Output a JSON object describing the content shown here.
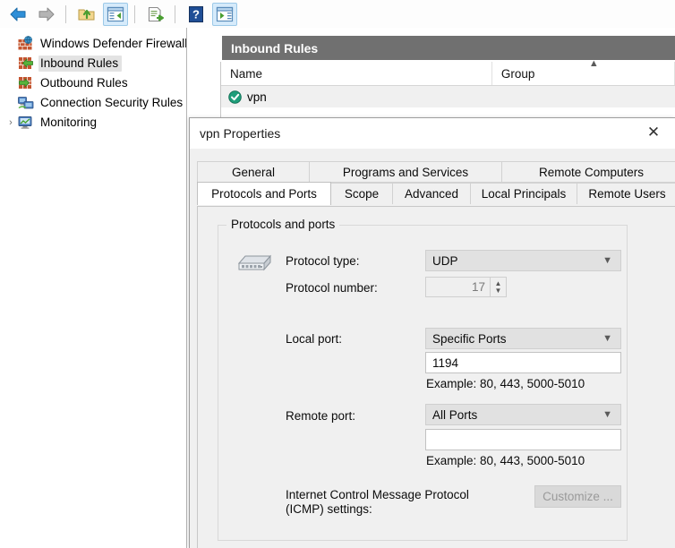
{
  "toolbar": {
    "buttons": [
      {
        "name": "back",
        "label": "Back",
        "icon": "back-arrow-icon",
        "checked": false
      },
      {
        "name": "forward",
        "label": "Forward",
        "icon": "forward-arrow-icon",
        "checked": false
      },
      {
        "name": "up-folder",
        "label": "Up One Level",
        "icon": "up-folder-icon",
        "checked": false
      },
      {
        "name": "show-hide-tree",
        "label": "Show/Hide Console Tree",
        "icon": "console-tree-icon",
        "checked": true
      },
      {
        "name": "export-list",
        "label": "Export List",
        "icon": "export-list-icon",
        "checked": false
      },
      {
        "name": "help",
        "label": "Help",
        "icon": "help-icon",
        "checked": false
      },
      {
        "name": "show-hide-action-pane",
        "label": "Show/Hide Action Pane",
        "icon": "action-pane-icon",
        "checked": true
      }
    ]
  },
  "tree": {
    "items": [
      {
        "label": "Windows Defender Firewall witl",
        "icon": "firewall-globe-icon",
        "indent": 0,
        "twisty": "",
        "selected": false
      },
      {
        "label": "Inbound Rules",
        "icon": "inbound-rules-icon",
        "indent": 1,
        "twisty": "",
        "selected": true
      },
      {
        "label": "Outbound Rules",
        "icon": "outbound-rules-icon",
        "indent": 1,
        "twisty": "",
        "selected": false
      },
      {
        "label": "Connection Security Rules",
        "icon": "connection-security-icon",
        "indent": 1,
        "twisty": "",
        "selected": false
      },
      {
        "label": "Monitoring",
        "icon": "monitoring-icon",
        "indent": 1,
        "twisty": "›",
        "selected": false
      }
    ]
  },
  "list": {
    "header": "Inbound Rules",
    "columns": [
      {
        "label": "Name",
        "sorted": false
      },
      {
        "label": "Group",
        "sorted": true,
        "sort_direction": "ascending"
      }
    ],
    "rows": [
      {
        "name": "vpn",
        "group": "",
        "icon": "enabled-check-icon"
      }
    ]
  },
  "dialog": {
    "title": "vpn Properties",
    "close_label": "✕",
    "tabs_row1": [
      {
        "label": "General",
        "active": false
      },
      {
        "label": "Programs and Services",
        "active": false
      },
      {
        "label": "Remote Computers",
        "active": false
      }
    ],
    "tabs_row2": [
      {
        "label": "Protocols and Ports",
        "active": true
      },
      {
        "label": "Scope",
        "active": false
      },
      {
        "label": "Advanced",
        "active": false
      },
      {
        "label": "Local Principals",
        "active": false
      },
      {
        "label": "Remote Users",
        "active": false
      }
    ],
    "group_title": "Protocols and ports",
    "protocol_icon": "network-switch-icon",
    "fields": {
      "protocol_type_label": "Protocol type:",
      "protocol_type_value": "UDP",
      "protocol_number_label": "Protocol number:",
      "protocol_number_value": "17",
      "local_port_label": "Local port:",
      "local_port_value": "Specific Ports",
      "local_port_list": "1194",
      "local_port_example": "Example: 80, 443, 5000-5010",
      "remote_port_label": "Remote port:",
      "remote_port_value": "All Ports",
      "remote_port_list": "",
      "remote_port_example": "Example: 80, 443, 5000-5010",
      "icmp_label": "Internet Control Message Protocol\n(ICMP) settings:",
      "icmp_button": "Customize ..."
    }
  },
  "colors": {
    "header_bar": "#707070",
    "selection": "#e3e3e3",
    "toolbar_checked": "#d6ebfb",
    "dialog_bg": "#f0f0f0"
  }
}
